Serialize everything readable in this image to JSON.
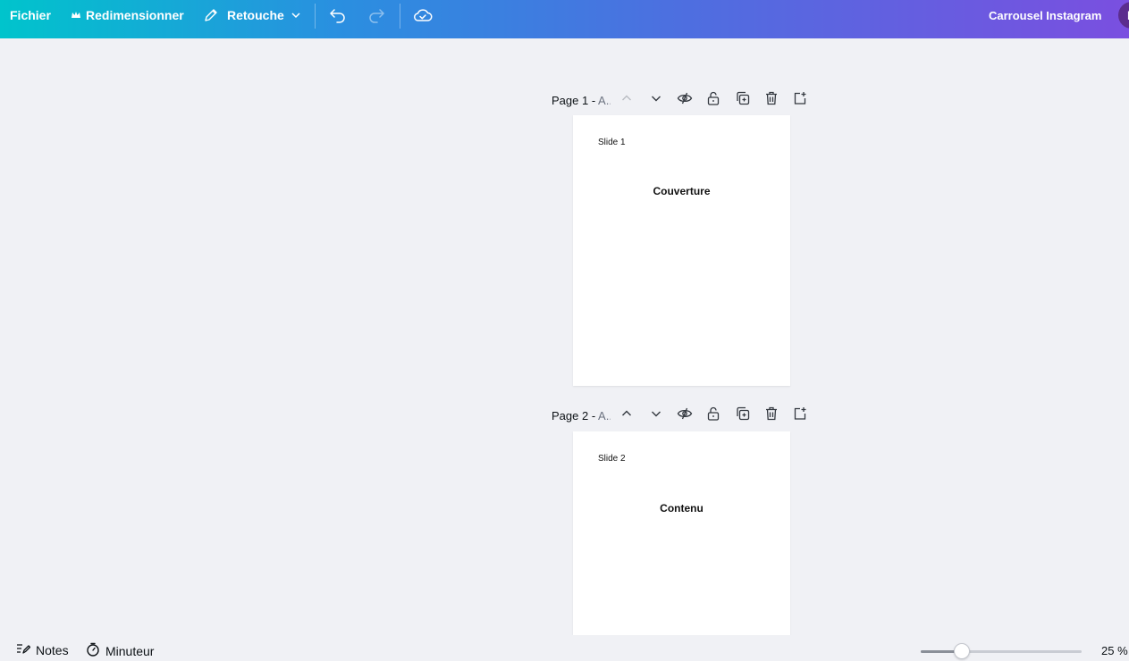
{
  "topbar": {
    "file_label": "Fichier",
    "resize_label": "Redimensionner",
    "edit_label": "Retouche",
    "doc_title": "Carrousel Instagram",
    "avatar_initial": "L",
    "icons": {
      "resize": "crown-icon",
      "edit": "pencil-icon",
      "edit_menu": "chevron-down-icon",
      "undo": "undo-icon",
      "redo": "redo-icon",
      "save": "cloud-check-icon"
    },
    "redo_enabled": false
  },
  "pages": [
    {
      "title_prefix": "Page 1 - ",
      "title_suffix": "A..",
      "label": "Slide 1",
      "heading": "Couverture",
      "move_up_enabled": false,
      "move_down_enabled": true
    },
    {
      "title_prefix": "Page 2 - ",
      "title_suffix": "A..",
      "label": "Slide 2",
      "heading": "Contenu",
      "move_up_enabled": true,
      "move_down_enabled": true
    }
  ],
  "page_actions": [
    "chevron-up-icon",
    "chevron-down-icon",
    "eye-hidden-icon",
    "lock-open-icon",
    "duplicate-icon",
    "trash-icon",
    "add-page-icon"
  ],
  "footer": {
    "notes_label": "Notes",
    "timer_label": "Minuteur",
    "zoom_value": "25 %",
    "zoom_fraction": 0.25
  },
  "colors": {
    "topbar_gradient_start": "#00c4cc",
    "topbar_gradient_end": "#7a4fe0",
    "canvas_bg": "#f0f1f5"
  }
}
